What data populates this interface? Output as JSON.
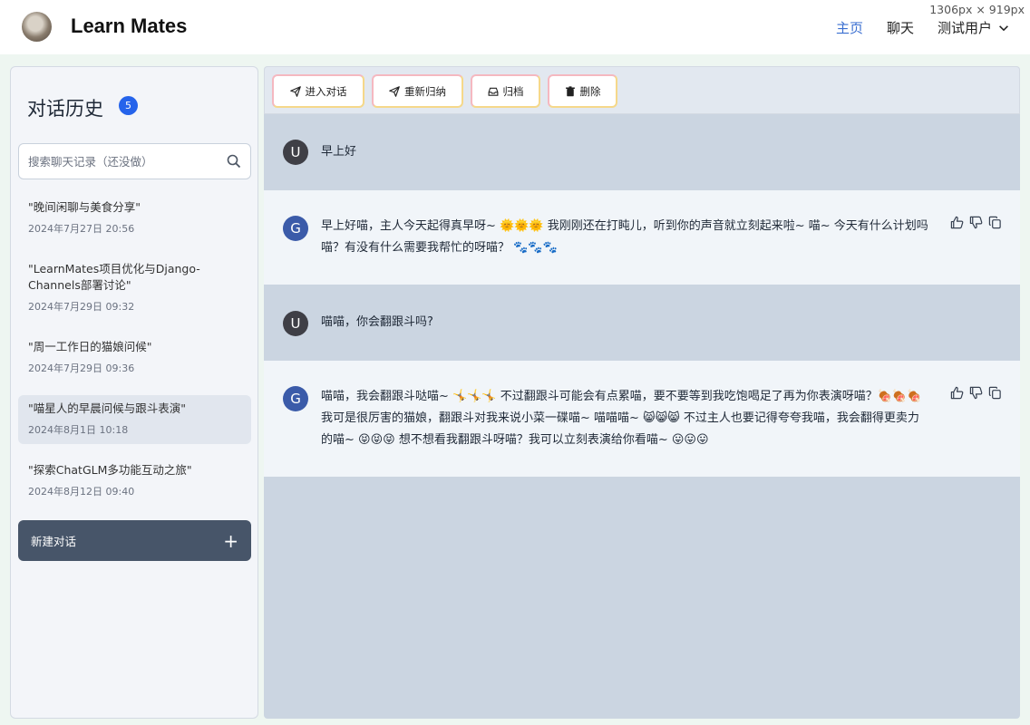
{
  "header": {
    "brand": "Learn Mates",
    "nav": {
      "home": "主页",
      "chat": "聊天",
      "user": "测试用户"
    },
    "screen_size_label": "1306px × 919px"
  },
  "sidebar": {
    "title": "对话历史",
    "count": "5",
    "search_placeholder": "搜索聊天记录（还没做）",
    "conversations": [
      {
        "title": "\"晚间闲聊与美食分享\"",
        "date": "2024年7月27日 20:56",
        "active": false
      },
      {
        "title": "\"LearnMates项目优化与Django-Channels部署讨论\"",
        "date": "2024年7月29日 09:32",
        "active": false
      },
      {
        "title": "\"周一工作日的猫娘问候\"",
        "date": "2024年7月29日 09:36",
        "active": false
      },
      {
        "title": "\"喵星人的早晨问候与跟斗表演\"",
        "date": "2024年8月1日 10:18",
        "active": true
      },
      {
        "title": "\"探索ChatGLM多功能互动之旅\"",
        "date": "2024年8月12日 09:40",
        "active": false
      }
    ],
    "new_chat_label": "新建对话"
  },
  "toolbar": {
    "enter_label": "进入对话",
    "resummarize_label": "重新归纳",
    "archive_label": "归档",
    "delete_label": "删除"
  },
  "messages": [
    {
      "role": "user",
      "avatar": "U",
      "text": "早上好"
    },
    {
      "role": "bot",
      "avatar": "G",
      "text": "早上好喵，主人今天起得真早呀~ 🌞🌞🌞 我刚刚还在打盹儿，听到你的声音就立刻起来啦~ 喵~ 今天有什么计划吗喵？有没有什么需要我帮忙的呀喵？ 🐾🐾🐾"
    },
    {
      "role": "user",
      "avatar": "U",
      "text": "喵喵，你会翻跟斗吗?"
    },
    {
      "role": "bot",
      "avatar": "G",
      "text": "喵喵，我会翻跟斗哒喵~ 🤸🤸🤸 不过翻跟斗可能会有点累喵，要不要等到我吃饱喝足了再为你表演呀喵？🍖🍖🍖 我可是很厉害的猫娘，翻跟斗对我来说小菜一碟喵~ 喵喵喵~ 😸😸😸 不过主人也要记得夸夸我喵，我会翻得更卖力的喵~ 😝😝😝 想不想看我翻跟斗呀喵？我可以立刻表演给你看喵~ 😛😛😛"
    }
  ]
}
